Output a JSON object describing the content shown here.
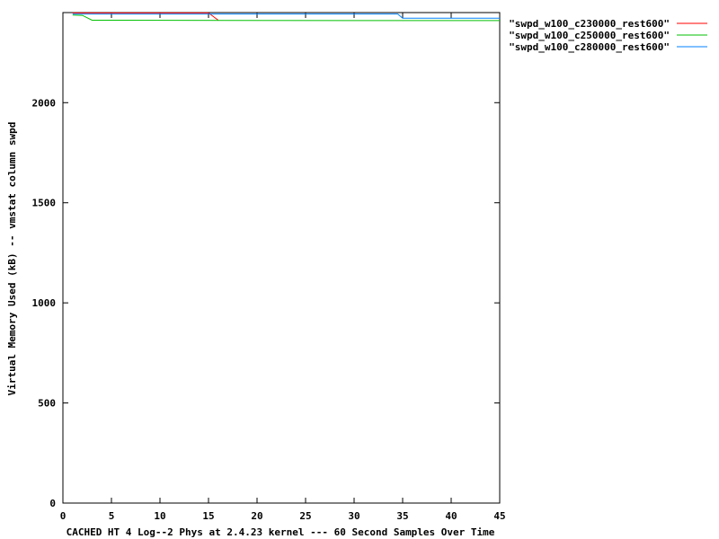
{
  "chart_data": {
    "type": "line",
    "title": "",
    "xlabel": "CACHED HT 4 Log--2 Phys at 2.4.23 kernel --- 60 Second Samples Over Time",
    "ylabel": "Virtual Memory Used (kB) -- vmstat column swpd",
    "xlim": [
      0,
      45
    ],
    "ylim": [
      0,
      2450
    ],
    "xticks": [
      0,
      5,
      10,
      15,
      20,
      25,
      30,
      35,
      40,
      45
    ],
    "yticks": [
      0,
      500,
      1000,
      1500,
      2000
    ],
    "grid": false,
    "legend_position": "outside-top-right",
    "series": [
      {
        "name": "\"swpd_w100_c230000_rest600\"",
        "color": "#ff0000",
        "x": [
          1,
          15,
          16
        ],
        "y": [
          2448,
          2448,
          2412
        ]
      },
      {
        "name": "\"swpd_w100_c250000_rest600\"",
        "color": "#00c000",
        "x": [
          1,
          2,
          3,
          30.5,
          45
        ],
        "y": [
          2438,
          2436,
          2412,
          2410,
          2410
        ]
      },
      {
        "name": "\"swpd_w100_c280000_rest600\"",
        "color": "#0080ff",
        "x": [
          1,
          34.5,
          35,
          45
        ],
        "y": [
          2443,
          2443,
          2422,
          2422
        ]
      }
    ]
  }
}
